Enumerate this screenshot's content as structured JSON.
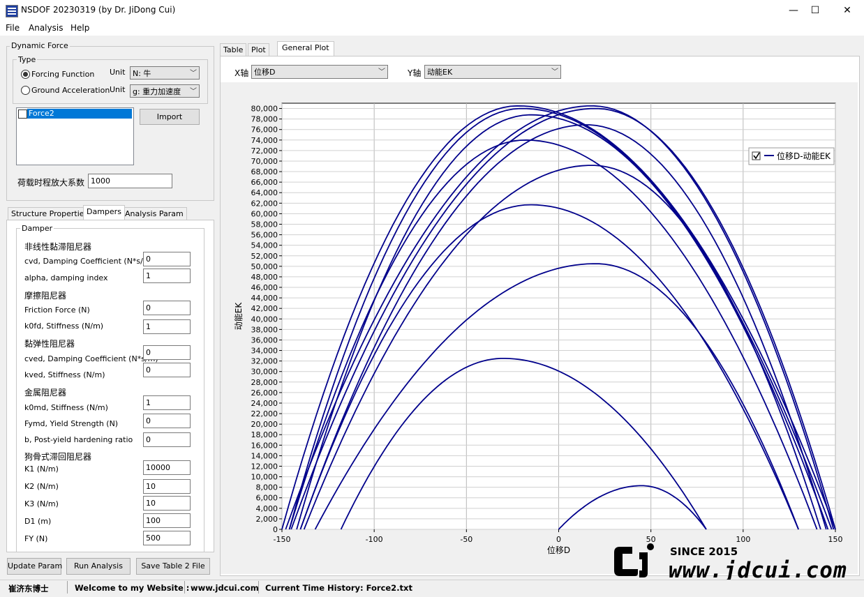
{
  "window": {
    "title": "NSDOF 20230319 (by Dr. JiDong Cui)",
    "minimize": "—",
    "maximize": "☐",
    "close": "✕"
  },
  "menu": [
    "File",
    "Analysis",
    "Help"
  ],
  "dynamic_force": {
    "title": "Dynamic Force",
    "type_title": "Type",
    "forcing_label": "Forcing Function",
    "ground_label": "Ground Acceleration",
    "unit_label": "Unit",
    "unit_forcing": "N: 牛",
    "unit_ground": "g: 重力加速度",
    "list_items": [
      "Force2"
    ],
    "import_label": "Import",
    "scale_label": "荷载时程放大系数",
    "scale_value": "1000"
  },
  "left_tabs": [
    "Structure Properties",
    "Dampers",
    "Analysis Param"
  ],
  "damper": {
    "title": "Damper",
    "nonlinear_viscous": "非线性黏滞阻尼器",
    "cvd_label": "cvd, Damping Coefficient (N*s/m)",
    "cvd_value": "0",
    "alpha_label": "alpha, damping index",
    "alpha_value": "1",
    "friction": "摩擦阻尼器",
    "friction_label": "Friction Force (N)",
    "friction_value": "0",
    "k0fd_label": "k0fd, Stiffness (N/m)",
    "k0fd_value": "1",
    "viscoelastic": "黏弹性阻尼器",
    "cved_label": "cved, Damping Coefficient (N*s/m)",
    "cved_value": "0",
    "kved_label": "kved, Stiffness (N/m)",
    "kved_value": "0",
    "metallic": "金属阻尼器",
    "k0md_label": "k0md, Stiffness (N/m)",
    "k0md_value": "1",
    "fymd_label": "Fymd, Yield Strength (N)",
    "fymd_value": "0",
    "b_label": "b, Post-yield hardening ratio",
    "b_value": "0",
    "dogbone": "狗骨式滞回阻尼器",
    "k1_label": "K1 (N/m)",
    "k1_value": "10000",
    "k2_label": "K2 (N/m)",
    "k2_value": "10",
    "k3_label": "K3 (N/m)",
    "k3_value": "10",
    "d1_label": "D1 (m)",
    "d1_value": "100",
    "fy_label": "FY (N)",
    "fy_value": "500"
  },
  "buttons": {
    "update": "Update Param",
    "run": "Run Analysis",
    "save": "Save Table 2 File"
  },
  "right_tabs": [
    "Table",
    "Plot",
    "General Plot"
  ],
  "axis_select": {
    "x_label": "X轴",
    "x_value": "位移D",
    "y_label": "Y轴",
    "y_value": "动能EK"
  },
  "watermark": {
    "since": "SINCE 2015",
    "site": "www.jdcui.com"
  },
  "status": {
    "author": "崔济东博士",
    "welcome": "Welcome to my Website :",
    "site": "www.jdcui.com",
    "current": "Current Time History: Force2.txt"
  },
  "chart_data": {
    "type": "line",
    "xlabel": "位移D",
    "ylabel": "动能EK",
    "xlim": [
      -150,
      150
    ],
    "ylim": [
      0,
      81000
    ],
    "xticks": [
      "-150",
      "-100",
      "-50",
      "0",
      "50",
      "100",
      "150"
    ],
    "xtick_values": [
      -150,
      -100,
      -50,
      0,
      50,
      100,
      150
    ],
    "yticks": [
      "0",
      "2,000",
      "4,000",
      "6,000",
      "8,000",
      "10,000",
      "12,000",
      "14,000",
      "16,000",
      "18,000",
      "20,000",
      "22,000",
      "24,000",
      "26,000",
      "28,000",
      "30,000",
      "32,000",
      "34,000",
      "36,000",
      "38,000",
      "40,000",
      "42,000",
      "44,000",
      "46,000",
      "48,000",
      "50,000",
      "52,000",
      "54,000",
      "56,000",
      "58,000",
      "60,000",
      "62,000",
      "64,000",
      "66,000",
      "68,000",
      "70,000",
      "72,000",
      "74,000",
      "76,000",
      "78,000",
      "80,000"
    ],
    "grid": true,
    "legend": {
      "position": "top-right",
      "checked": true
    },
    "series": [
      {
        "name": "位移D-动能EK",
        "color": "#00008b",
        "arches": [
          {
            "x0": -150,
            "x1": 150,
            "xp": -22,
            "peak": 80500
          },
          {
            "x0": -148,
            "x1": 149,
            "xp": 18,
            "peak": 80500
          },
          {
            "x0": -146,
            "x1": 148,
            "xp": -20,
            "peak": 80000
          },
          {
            "x0": -145,
            "x1": 150,
            "xp": 20,
            "peak": 80000
          },
          {
            "x0": -142,
            "x1": 146,
            "xp": -15,
            "peak": 78800
          },
          {
            "x0": -140,
            "x1": 145,
            "xp": 15,
            "peak": 76900
          },
          {
            "x0": -146,
            "x1": 140,
            "xp": -18,
            "peak": 74000
          },
          {
            "x0": -138,
            "x1": 142,
            "xp": 18,
            "peak": 69200
          },
          {
            "x0": -140,
            "x1": 130,
            "xp": -15,
            "peak": 61700
          },
          {
            "x0": -132,
            "x1": 130,
            "xp": 20,
            "peak": 50500
          },
          {
            "x0": -118,
            "x1": 80,
            "xp": -30,
            "peak": 32500
          },
          {
            "x0": 0,
            "x1": 80,
            "xp": 45,
            "peak": 8300
          }
        ]
      }
    ]
  }
}
